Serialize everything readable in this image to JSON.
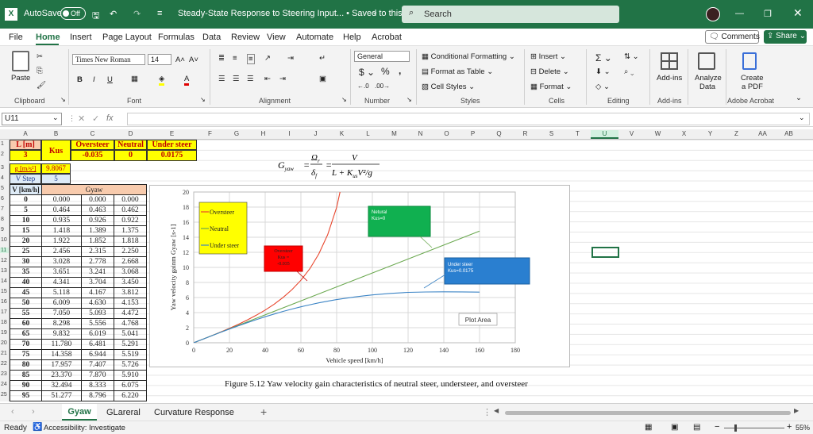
{
  "app": {
    "autosave_label": "AutoSave",
    "autosave_state": "Off",
    "doc_title": "Steady-State Response to Steering Input... • Saved to this PC",
    "search_placeholder": "Search",
    "accent": "#217346"
  },
  "menu": [
    "File",
    "Home",
    "Insert",
    "Page Layout",
    "Formulas",
    "Data",
    "Review",
    "View",
    "Automate",
    "Help",
    "Acrobat"
  ],
  "menu_active": "Home",
  "comments_label": "Comments",
  "share_label": "Share",
  "ribbon": {
    "paste": "Paste",
    "font_name": "Times New Roman",
    "font_size": "14",
    "number_format": "General",
    "conditional": "Conditional Formatting",
    "format_table": "Format as Table",
    "cell_styles": "Cell Styles",
    "insert": "Insert",
    "delete": "Delete",
    "format": "Format",
    "addins": "Add-ins",
    "analyze": "Analyze",
    "analyze2": "Data",
    "create_pdf": "Create",
    "create_pdf2": "a PDF",
    "groups": [
      "Clipboard",
      "Font",
      "Alignment",
      "Number",
      "Styles",
      "Cells",
      "Editing",
      "Add-ins",
      "Adobe Acrobat"
    ]
  },
  "formula_bar": {
    "name_box": "U11",
    "fx": "fx",
    "value": ""
  },
  "columns": [
    "A",
    "B",
    "C",
    "D",
    "E",
    "F",
    "G",
    "H",
    "I",
    "J",
    "K",
    "L",
    "M",
    "N",
    "O",
    "P",
    "Q",
    "R",
    "S",
    "T",
    "U",
    "V",
    "W",
    "X",
    "Y",
    "Z",
    "AA",
    "AB"
  ],
  "selected_column": "U",
  "rows": [
    "1",
    "2",
    "3",
    "4",
    "5",
    "6",
    "7",
    "8",
    "9",
    "10",
    "11",
    "12",
    "13",
    "14",
    "15",
    "16",
    "17",
    "18",
    "19",
    "20",
    "21",
    "22",
    "23",
    "24",
    "25"
  ],
  "params": {
    "L_label": "L [m]",
    "L_value": "3",
    "Kus_label": "Kus",
    "oversteer_label": "Oversteer",
    "oversteer_value": "-0.035",
    "neutral_label": "Neutral",
    "neutral_value": "0",
    "understeer_label": "Under steer",
    "understeer_value": "0.0175",
    "g_label": "g [m/s²]",
    "g_value": "9.8067",
    "vstep_label": "V Step",
    "vstep_value": "5",
    "v_header": "V [km/h]",
    "gyaw_header": "Gyaw"
  },
  "table": [
    [
      "0",
      "0.000",
      "0.000",
      "0.000"
    ],
    [
      "5",
      "0.464",
      "0.463",
      "0.462"
    ],
    [
      "10",
      "0.935",
      "0.926",
      "0.922"
    ],
    [
      "15",
      "1.418",
      "1.389",
      "1.375"
    ],
    [
      "20",
      "1.922",
      "1.852",
      "1.818"
    ],
    [
      "25",
      "2.456",
      "2.315",
      "2.250"
    ],
    [
      "30",
      "3.028",
      "2.778",
      "2.668"
    ],
    [
      "35",
      "3.651",
      "3.241",
      "3.068"
    ],
    [
      "40",
      "4.341",
      "3.704",
      "3.450"
    ],
    [
      "45",
      "5.118",
      "4.167",
      "3.812"
    ],
    [
      "50",
      "6.009",
      "4.630",
      "4.153"
    ],
    [
      "55",
      "7.050",
      "5.093",
      "4.472"
    ],
    [
      "60",
      "8.298",
      "5.556",
      "4.768"
    ],
    [
      "65",
      "9.832",
      "6.019",
      "5.041"
    ],
    [
      "70",
      "11.780",
      "6.481",
      "5.291"
    ],
    [
      "75",
      "14.358",
      "6.944",
      "5.519"
    ],
    [
      "80",
      "17.957",
      "7.407",
      "5.726"
    ],
    [
      "85",
      "23.370",
      "7.870",
      "5.910"
    ],
    [
      "90",
      "32.494",
      "8.333",
      "6.075"
    ],
    [
      "95",
      "51.277",
      "8.796",
      "6.220"
    ]
  ],
  "formula_text": {
    "g": "G",
    "yaw": "yaw",
    "eq": "=",
    "omega": "Ω",
    "r": "r",
    "delta": "δ",
    "f": "f",
    "v": "V",
    "den": "L + K",
    "us": "us",
    "v2g": "V²/g"
  },
  "chart_data": {
    "type": "line",
    "xlabel": "Vehicle speed [km/h]",
    "ylabel": "Yaw velocity gainm Gyaw [s-1]",
    "xlim": [
      0,
      180
    ],
    "ylim": [
      0,
      20
    ],
    "xticks": [
      "0",
      "20",
      "40",
      "60",
      "80",
      "100",
      "120",
      "140",
      "160",
      "180"
    ],
    "yticks": [
      "0",
      "2",
      "4",
      "6",
      "8",
      "10",
      "12",
      "14",
      "16",
      "18",
      "20"
    ],
    "legend_position": "top-left",
    "legend": [
      "Oversteer",
      "Neutral",
      "Under steer"
    ],
    "series": [
      {
        "name": "Oversteer",
        "color": "#e8452c",
        "x": [
          0,
          5,
          10,
          15,
          20,
          25,
          30,
          35,
          40,
          45,
          50,
          55,
          60,
          65,
          70,
          75,
          80,
          85,
          90,
          95
        ],
        "values": [
          0,
          0.464,
          0.935,
          1.418,
          1.922,
          2.456,
          3.028,
          3.651,
          4.341,
          5.118,
          6.009,
          7.05,
          8.298,
          9.832,
          11.78,
          14.358,
          17.957,
          23.37,
          32.494,
          51.277
        ]
      },
      {
        "name": "Neutral",
        "color": "#6aa84f",
        "x": [
          0,
          160
        ],
        "values": [
          0,
          14.815
        ]
      },
      {
        "name": "Under steer",
        "color": "#3d85c6",
        "x": [
          0,
          5,
          10,
          15,
          20,
          25,
          30,
          35,
          40,
          45,
          50,
          55,
          60,
          65,
          70,
          75,
          80,
          85,
          90,
          95,
          100,
          110,
          120,
          130,
          140,
          150,
          160
        ],
        "values": [
          0,
          0.462,
          0.922,
          1.375,
          1.818,
          2.25,
          2.668,
          3.068,
          3.45,
          3.812,
          4.153,
          4.472,
          4.768,
          5.041,
          5.291,
          5.519,
          5.726,
          5.91,
          6.075,
          6.22,
          6.35,
          6.55,
          6.68,
          6.74,
          6.76,
          6.75,
          6.72
        ]
      }
    ],
    "annotations": [
      {
        "text": "Oversteer",
        "text2": "Kus =",
        "text3": "-0.035",
        "color": "#e82020"
      },
      {
        "text": "Netural",
        "text2": "Kus=0",
        "color": "#10b050"
      },
      {
        "text": "Under steer",
        "text2": "Kus=0.0175",
        "color": "#2a7fd0"
      }
    ],
    "plot_area_tooltip": "Plot Area"
  },
  "caption": "Figure 5.12 Yaw velocity gain characteristics of neutral steer, understeer, and oversteer",
  "sheets": [
    "Gyaw",
    "GLareral",
    "Curvature Response"
  ],
  "active_sheet": "Gyaw",
  "status": {
    "ready": "Ready",
    "accessibility": "Accessibility: Investigate",
    "zoom": "55%"
  }
}
